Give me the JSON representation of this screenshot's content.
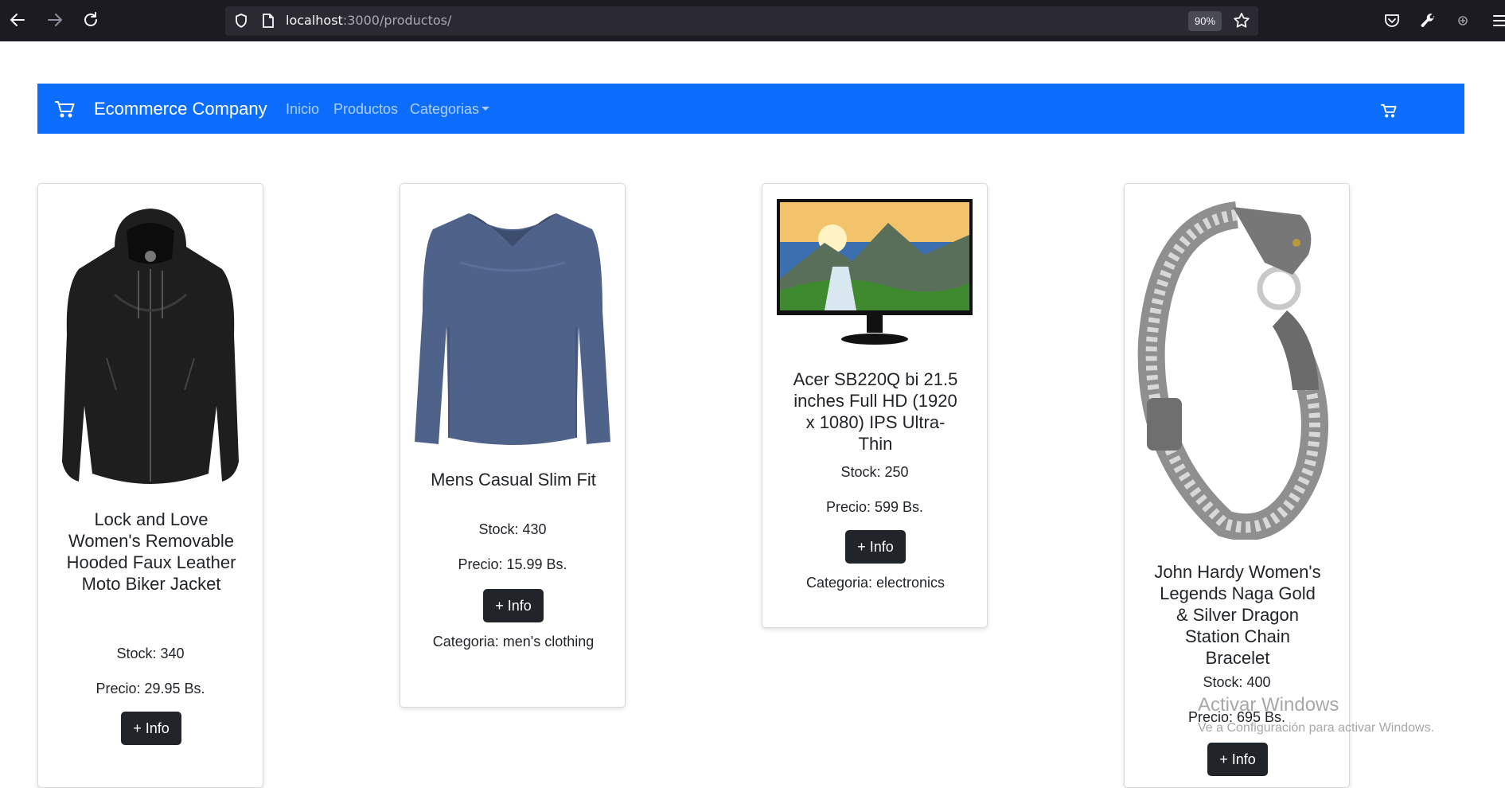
{
  "browser": {
    "url_host": "localhost",
    "url_path": ":3000/productos/",
    "zoom": "90%",
    "icons": [
      "back-icon",
      "forward-icon",
      "reload-icon",
      "shield-icon",
      "page-icon",
      "star-icon",
      "pocket-icon",
      "wrench-icon",
      "extension-icon",
      "menu-icon"
    ]
  },
  "navbar": {
    "brand": "Ecommerce Company",
    "links": [
      "Inicio",
      "Productos",
      "Categorias"
    ],
    "background": "#0d6efd",
    "icons": [
      "cart-icon",
      "cart-icon"
    ]
  },
  "products": [
    {
      "title": "Lock and Love Women's Removable Hooded Faux Leather Moto Biker Jacket",
      "stock": "Stock: 340",
      "price": "Precio: 29.95 Bs.",
      "button": "+ Info",
      "category": "",
      "image": "black-leather-jacket"
    },
    {
      "title": "Mens Casual Slim Fit",
      "stock": "Stock: 430",
      "price": "Precio: 15.99 Bs.",
      "button": "+ Info",
      "category": "Categoria: men's clothing",
      "image": "blue-long-sleeve-shirt"
    },
    {
      "title": "Acer SB220Q bi 21.5 inches Full HD (1920 x 1080) IPS Ultra-Thin",
      "stock": "Stock: 250",
      "price": "Precio: 599 Bs.",
      "button": "+ Info",
      "category": "Categoria: electronics",
      "image": "monitor-landscape"
    },
    {
      "title": "John Hardy Women's Legends Naga Gold & Silver Dragon Station Chain Bracelet",
      "stock": "Stock: 400",
      "price": "Precio: 695 Bs.",
      "button": "+ Info",
      "category": "",
      "image": "dragon-bracelet"
    }
  ],
  "watermark": {
    "line1": "Activar Windows",
    "line2": "Ve a Configuración para activar Windows."
  }
}
